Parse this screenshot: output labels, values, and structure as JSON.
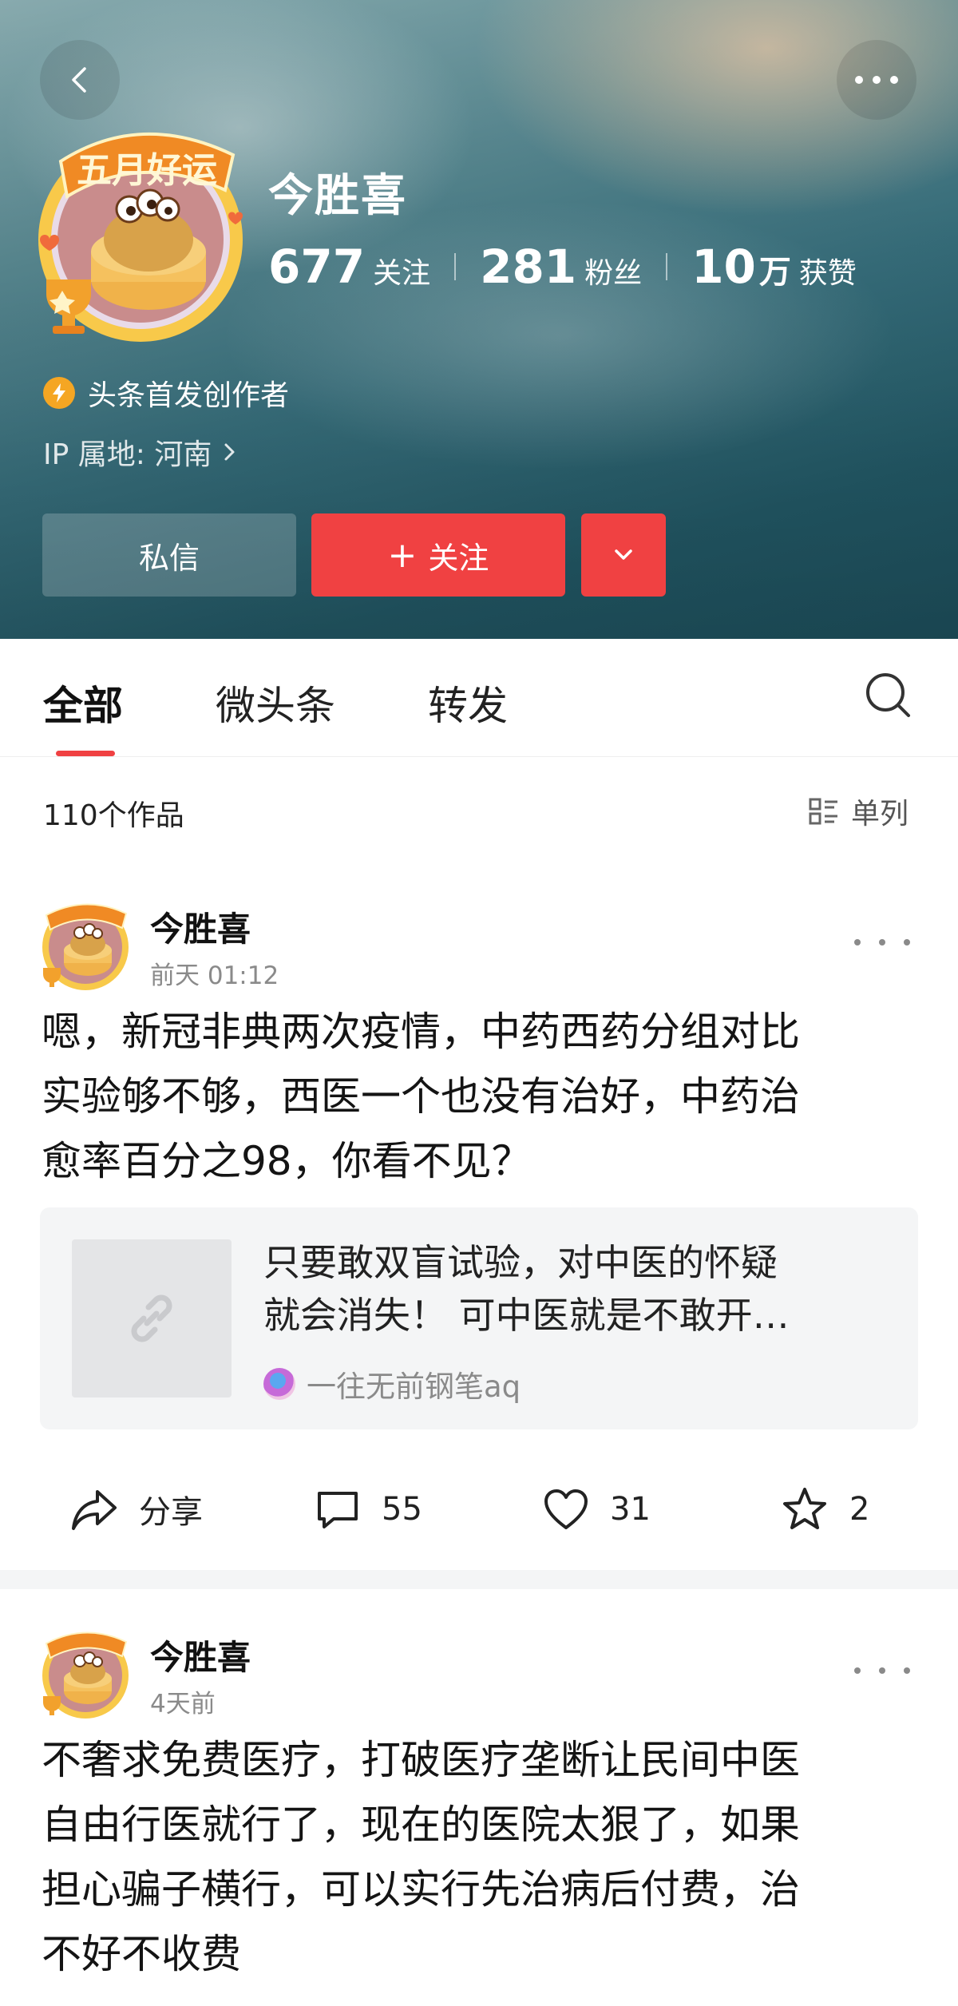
{
  "profile": {
    "name": "今胜喜",
    "avatar_badge_text": "五月好运",
    "stats": [
      {
        "num": "677",
        "unit": "",
        "label": "关注"
      },
      {
        "num": "281",
        "unit": "",
        "label": "粉丝"
      },
      {
        "num": "10",
        "unit": "万",
        "label": "获赞"
      }
    ],
    "badge": "头条首发创作者",
    "ip": "IP 属地: 河南"
  },
  "buttons": {
    "message": "私信",
    "follow": "关注",
    "follow_prefix": "+"
  },
  "tabs": [
    {
      "label": "全部",
      "active": true
    },
    {
      "label": "微头条",
      "active": false
    },
    {
      "label": "转发",
      "active": false
    }
  ],
  "works": {
    "count_label": "110个作品",
    "view_label": "单列"
  },
  "posts": [
    {
      "author": "今胜喜",
      "time": "前天  01:12",
      "text": "嗯，新冠非典两次疫情，中药西药分组对比\n实验够不够，西医一个也没有治好，中药治\n愈率百分之98，你看不见？",
      "link": {
        "title_line1": "只要敢双盲试验，对中医的怀疑",
        "title_line2": "就会消失！  可中医就是不敢开…",
        "source": "一往无前钢笔aq"
      },
      "actions": {
        "share": "分享",
        "comments": "55",
        "likes": "31",
        "favorites": "2"
      }
    },
    {
      "author": "今胜喜",
      "time": "4天前",
      "text": "不奢求免费医疗，打破医疗垄断让民间中医\n自由行医就行了，现在的医院太狠了，如果\n担心骗子横行，可以实行先治病后付费，治\n不好不收费"
    }
  ],
  "colors": {
    "accent": "#f04142",
    "header_teal": "#2f6b78"
  }
}
